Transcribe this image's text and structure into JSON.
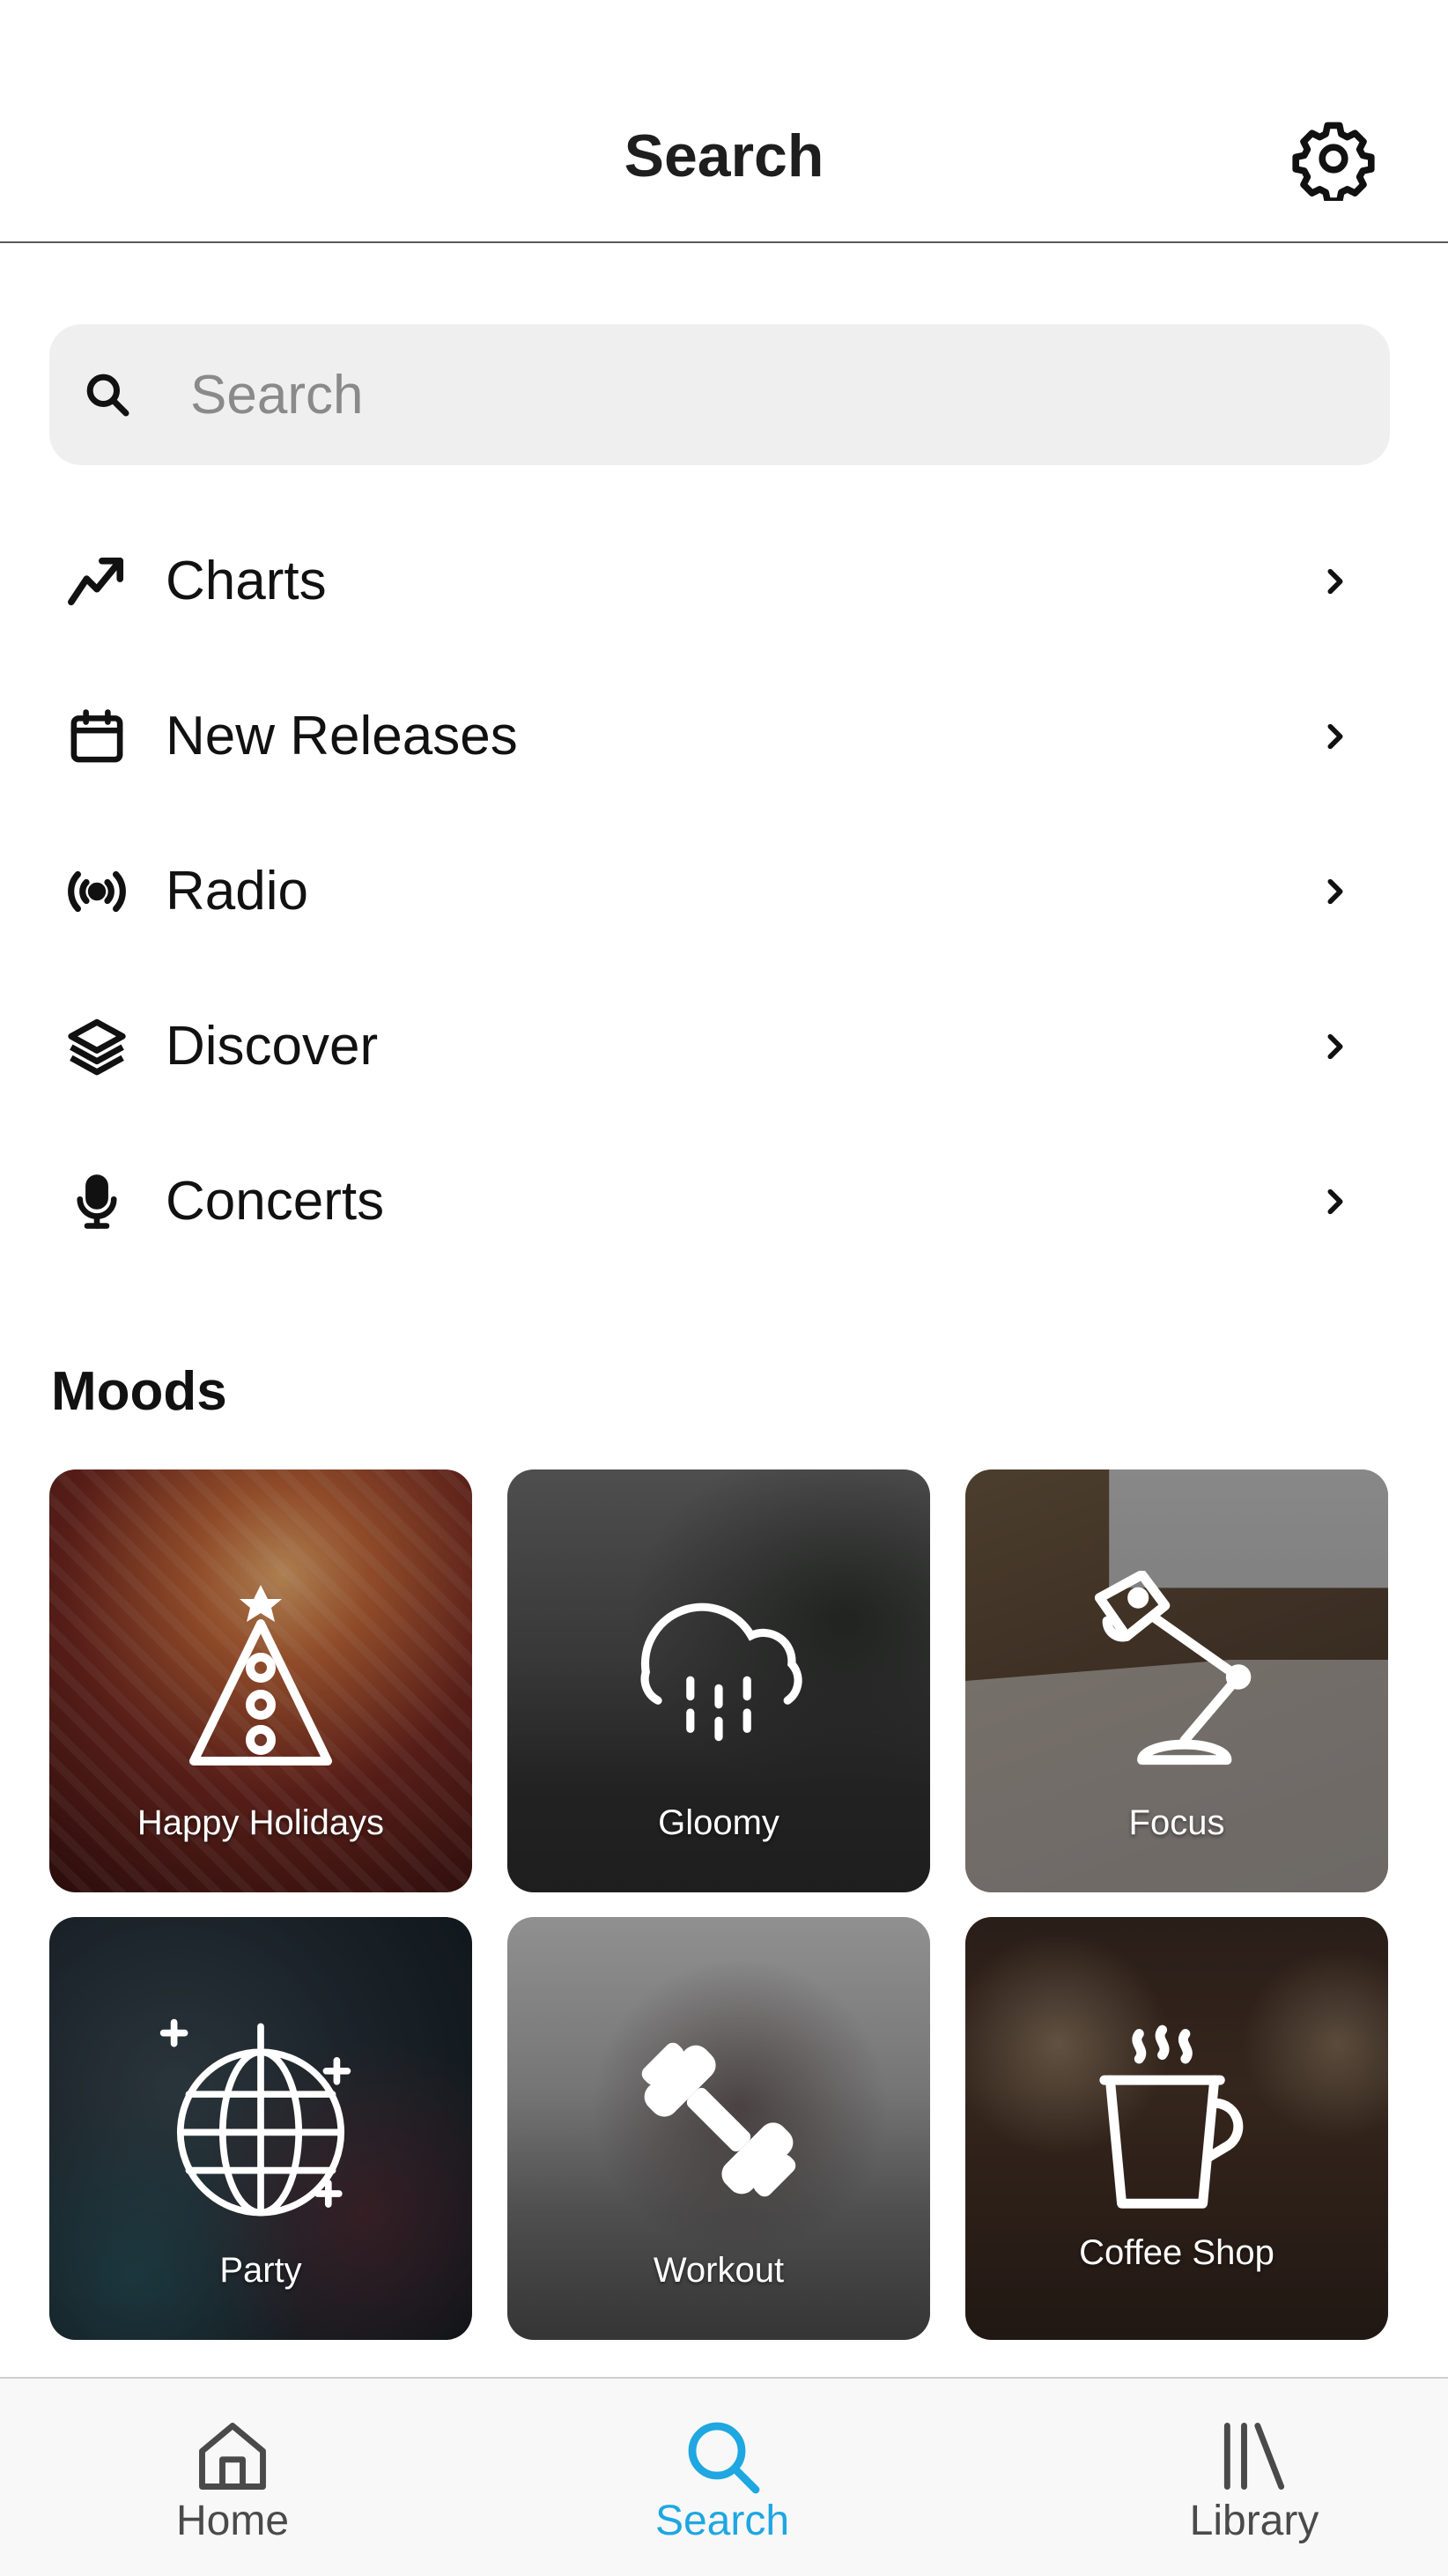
{
  "header": {
    "title": "Search",
    "settings_icon": "gear-icon"
  },
  "search": {
    "placeholder": "Search",
    "value": "",
    "icon": "search-icon"
  },
  "nav": [
    {
      "label": "Charts",
      "icon": "trending-up-icon"
    },
    {
      "label": "New Releases",
      "icon": "calendar-icon"
    },
    {
      "label": "Radio",
      "icon": "broadcast-icon"
    },
    {
      "label": "Discover",
      "icon": "layers-icon"
    },
    {
      "label": "Concerts",
      "icon": "microphone-icon"
    }
  ],
  "moods": {
    "title": "Moods",
    "tiles": [
      {
        "label": "Happy Holidays",
        "icon": "christmas-tree-icon"
      },
      {
        "label": "Gloomy",
        "icon": "rain-cloud-icon"
      },
      {
        "label": "Focus",
        "icon": "desk-lamp-icon"
      },
      {
        "label": "Party",
        "icon": "disco-ball-icon"
      },
      {
        "label": "Workout",
        "icon": "dumbbell-icon"
      },
      {
        "label": "Coffee Shop",
        "icon": "coffee-cup-icon"
      }
    ]
  },
  "tabbar": {
    "active_color": "#1ea7e1",
    "tabs": [
      {
        "label": "Home",
        "icon": "home-icon",
        "active": false
      },
      {
        "label": "Search",
        "icon": "search-icon",
        "active": true
      },
      {
        "label": "Library",
        "icon": "library-icon",
        "active": false
      }
    ]
  }
}
